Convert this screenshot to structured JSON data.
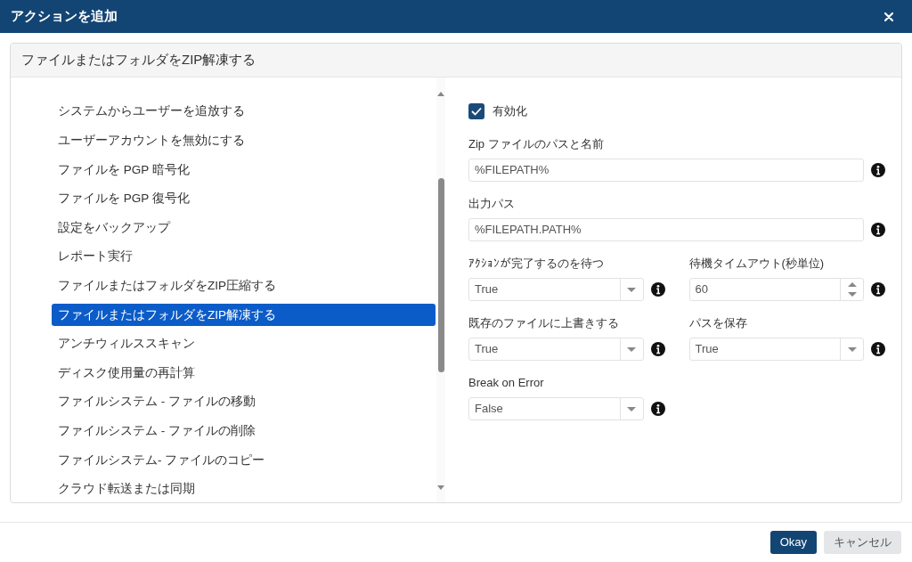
{
  "dialog": {
    "title": "アクションを追加"
  },
  "panel": {
    "title": "ファイルまたはフォルダをZIP解凍する"
  },
  "actions": [
    {
      "label": "システムからユーザーを追放する",
      "selected": false
    },
    {
      "label": "ユーザーアカウントを無効にする",
      "selected": false
    },
    {
      "label": "ファイルを PGP 暗号化",
      "selected": false
    },
    {
      "label": "ファイルを PGP 復号化",
      "selected": false
    },
    {
      "label": "設定をバックアップ",
      "selected": false
    },
    {
      "label": "レポート実行",
      "selected": false
    },
    {
      "label": "ファイルまたはフォルダをZIP圧縮する",
      "selected": false
    },
    {
      "label": "ファイルまたはフォルダをZIP解凍する",
      "selected": true
    },
    {
      "label": "アンチウィルススキャン",
      "selected": false
    },
    {
      "label": "ディスク使用量の再計算",
      "selected": false
    },
    {
      "label": "ファイルシステム - ファイルの移動",
      "selected": false
    },
    {
      "label": "ファイルシステム - ファイルの削除",
      "selected": false
    },
    {
      "label": "ファイルシステム- ファイルのコピー",
      "selected": false
    },
    {
      "label": "クラウド転送または同期",
      "selected": false
    }
  ],
  "form": {
    "enabled": {
      "label": "有効化",
      "checked": true
    },
    "rows": [
      [
        {
          "kind": "text",
          "label": "Zip ファイルのパスと名前",
          "value": "%FILEPATH%"
        }
      ],
      [
        {
          "kind": "text",
          "label": "出力パス",
          "value": "%FILEPATH.PATH%"
        }
      ],
      [
        {
          "kind": "select",
          "label": "ｱｸｼｮﾝが完了するのを待つ",
          "value": "True"
        },
        {
          "kind": "number",
          "label": "待機タイムアウト(秒単位)",
          "value": "60"
        }
      ],
      [
        {
          "kind": "select",
          "label": "既存のファイルに上書きする",
          "value": "True"
        },
        {
          "kind": "select",
          "label": "パスを保存",
          "value": "True"
        }
      ],
      [
        {
          "kind": "select",
          "label": "Break on Error",
          "value": "False"
        }
      ]
    ]
  },
  "buttons": [
    {
      "label": "Okay",
      "kind": "primary"
    },
    {
      "label": "キャンセル",
      "kind": "secondary"
    }
  ]
}
